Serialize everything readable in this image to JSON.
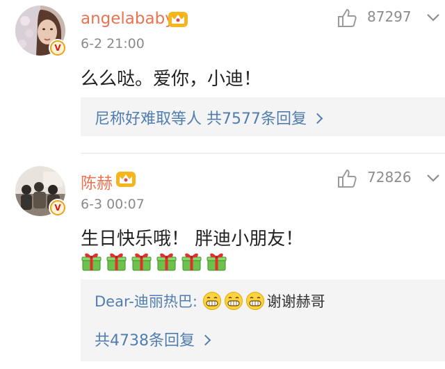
{
  "comments": [
    {
      "username": "angelababy",
      "time": "6-2 21:00",
      "likes": "87297",
      "content": "么么哒。爱你，小迪！",
      "reply_summary": "尼称好难取等人 共7577条回复",
      "icons": {
        "avatar": "avatar-portrait",
        "verified": "verified-v-icon",
        "crown": "vip-crown-icon",
        "like": "thumb-up-icon",
        "more": "chevron-down-icon",
        "arrow": "chevron-right-icon"
      }
    },
    {
      "username": "陈赫",
      "time": "6-3 00:07",
      "likes": "72826",
      "content": "生日快乐哦！ 胖迪小朋友！",
      "gift_count": 6,
      "reply": {
        "user": "Dear-迪丽热巴:",
        "text": "谢谢赫哥",
        "emoji_count": 3,
        "emoji": "grin-emoji"
      },
      "reply_summary": "共4738条回复",
      "icons": {
        "avatar": "avatar-group-photo",
        "verified": "verified-v-icon",
        "crown": "vip-crown-icon",
        "like": "thumb-up-icon",
        "more": "chevron-down-icon",
        "gift": "gift-icon",
        "arrow": "chevron-right-icon"
      }
    }
  ],
  "colors": {
    "username": "#eb7350",
    "link": "#507daf",
    "reply_bg": "#f4f4f4",
    "verified_badge": "#e8a31a"
  }
}
